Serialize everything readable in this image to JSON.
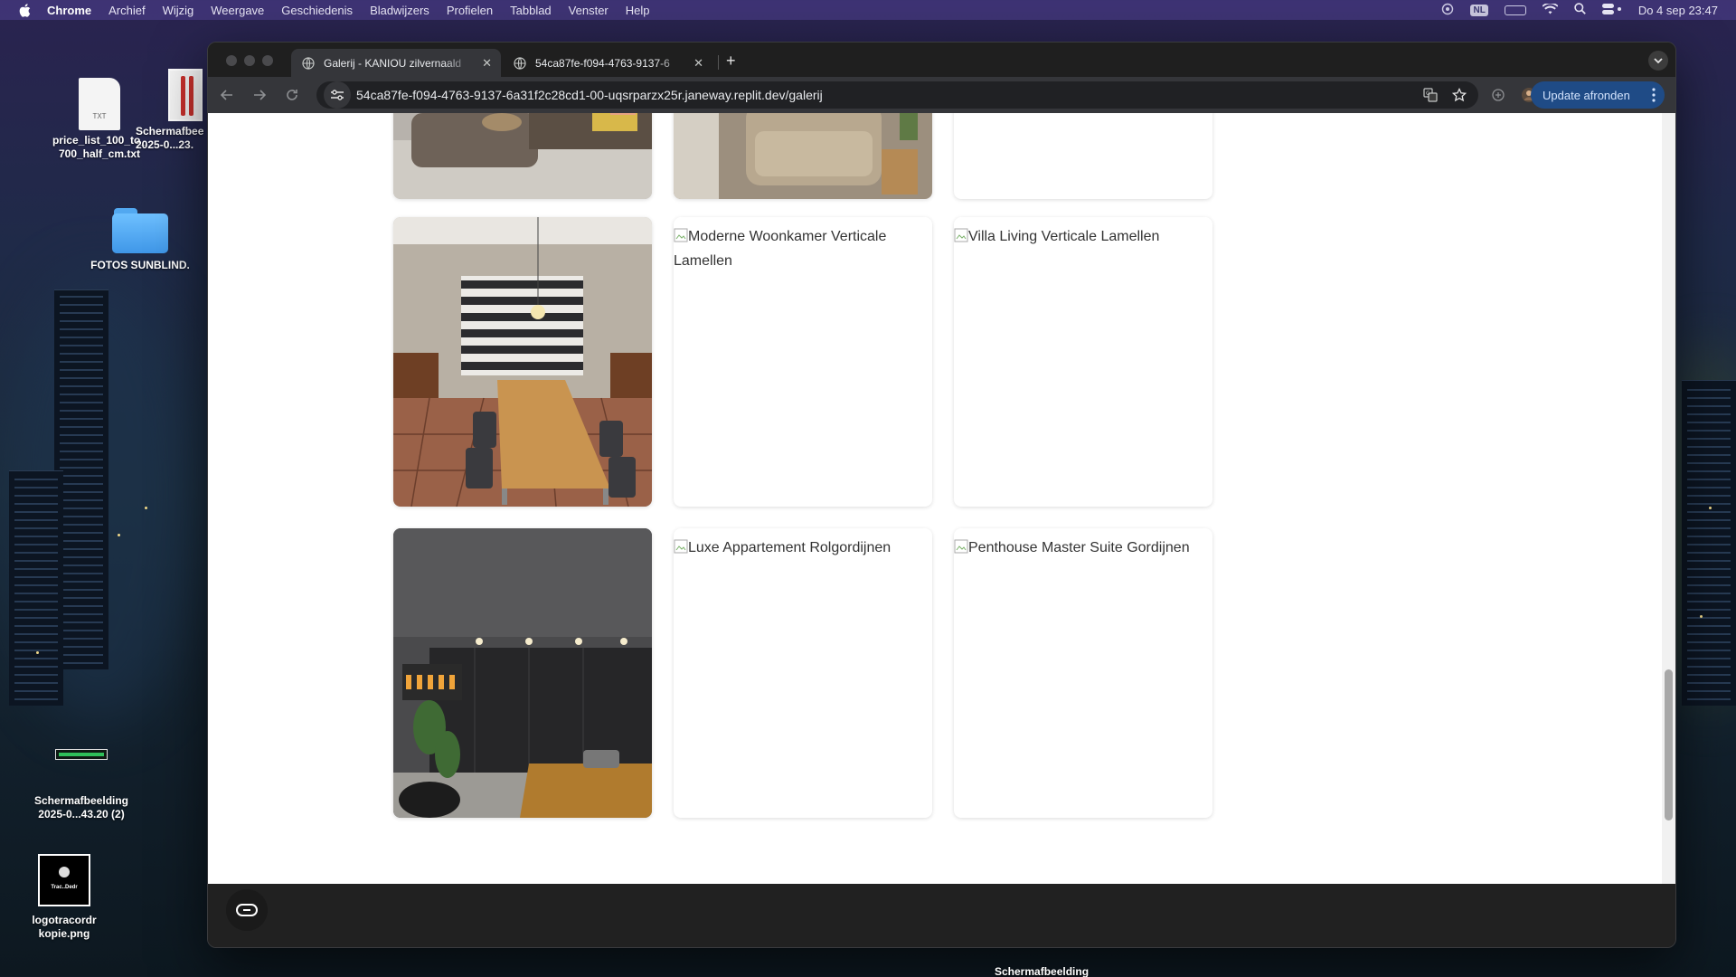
{
  "menubar": {
    "app": "Chrome",
    "items": [
      "Archief",
      "Wijzig",
      "Weergave",
      "Geschiedenis",
      "Bladwijzers",
      "Profielen",
      "Tabblad",
      "Venster",
      "Help"
    ],
    "input_source": "NL",
    "datetime": "Do 4 sep  23:47"
  },
  "desktop": {
    "icons": [
      {
        "label": "price_list_100_to_700_half_cm.txt",
        "line1": "price_list_100_to_",
        "line2": "700_half_cm.txt",
        "type_badge": "TXT"
      },
      {
        "label": "Schermafbeelding 2025-0...23.",
        "line1": "Schermafbee",
        "line2": "2025-0...23."
      },
      {
        "label": "FOTOS SUNBLIND.",
        "line1": "FOTOS SUNBLIND."
      },
      {
        "label": "Schermafbeelding 2025-0...43.20 (2)",
        "line1": "Schermafbeelding",
        "line2": "2025-0...43.20 (2)"
      },
      {
        "label": "logotracordr kopie.png",
        "line1": "logotracordr",
        "line2": "kopie.png"
      }
    ],
    "bottom_label": "Schermafbeelding"
  },
  "browser": {
    "tabs": [
      {
        "title": "Galerij - KANIOU zilvernaald",
        "active": true
      },
      {
        "title": "54ca87fe-f094-4763-9137-6",
        "active": false
      }
    ],
    "url": "54ca87fe-f094-4763-9137-6a31f2c28cd1-00-uqsrparzx25r.janeway.replit.dev/galerij",
    "update_button": "Update afronden"
  },
  "gallery": {
    "row2": [
      {
        "type": "photo",
        "subject": "dining room with zebra blinds"
      },
      {
        "type": "broken",
        "alt": "Moderne Woonkamer Verticale Lamellen"
      },
      {
        "type": "broken",
        "alt": "Villa Living Verticale Lamellen"
      }
    ],
    "row3": [
      {
        "type": "photo",
        "subject": "living room with dark roller blinds"
      },
      {
        "type": "broken",
        "alt": "Luxe Appartement Rolgordijnen"
      },
      {
        "type": "broken",
        "alt": "Penthouse Master Suite Gordijnen"
      }
    ]
  },
  "colors": {
    "accent_update": "#1f4b86",
    "page_bg": "#ffffff",
    "footer_bg": "#212121"
  }
}
